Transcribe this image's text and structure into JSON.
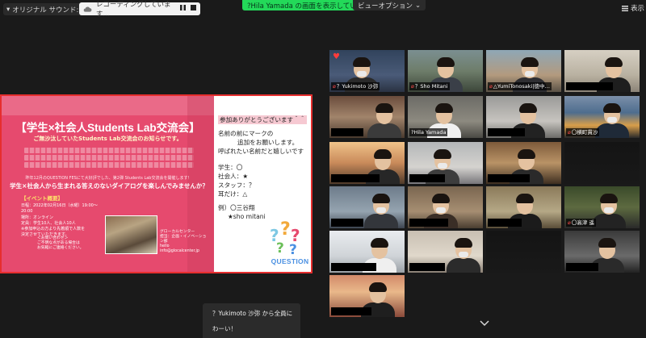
{
  "topbar": {
    "sound_label": "オリジナル サウンド: オフ",
    "recording_label": "レコーディングしています...",
    "share_banner": "?Hila Yamada の画面を表示しています",
    "view_options": "ビューオプション",
    "view_label": "表示"
  },
  "slide": {
    "title": "【学生×社会人Students Lab交流会】",
    "subtitle": "ご無沙汰していたStudents Lab交流会のお知らせです。",
    "small_text": "昨年12月のQUESTION FESにて大好評でした、第2弾 Students Lab交流会を開催します！",
    "question": "学生×社会人から生まれる答えのないダイアログを楽しんでみませんか？",
    "info_heading": "【イベント概要】",
    "info_lines": [
      "日程：2022年02月16日（水曜）19:00～20:00",
      "場所：オンライン",
      "定員：学生10人、社会人10人",
      "※参加申込の方より先着順で人数を",
      "決定させていただきます。"
    ],
    "contact_lines": [
      "＜お問い合わせ＞",
      "ご不明な点がある場合は",
      "お気軽にご連絡ください。"
    ],
    "contact2_lines": [
      "グローカルセンター",
      "担当：企画・イノベーション部",
      "hello",
      "info@glocalcenter.jp"
    ],
    "message_greeting": "参加ありがとうございます＾＾",
    "message_lines": [
      "名前の前にマークの",
      "追加をお願いします。",
      "呼ばれたい名前だと嬉しいです"
    ],
    "marks": [
      "学生：〇",
      "社会人：★",
      "スタッフ：？",
      "耳だけ：△"
    ],
    "example_label": "例）〇三谷翔",
    "example_2": "★sho mitani",
    "logo_text": "QUESTION"
  },
  "gallery": {
    "participants": [
      {
        "name": "？Yukimoto 沙弥",
        "muted": true,
        "heart": true
      },
      {
        "name": "？Sho Mitani",
        "muted": true
      },
      {
        "name": "△YumiTonosaki|徳中…",
        "muted": true
      },
      {
        "name": "",
        "muted": false
      },
      {
        "name": "",
        "muted": false
      },
      {
        "name": "?Hila Yamada",
        "muted": false,
        "active": true
      },
      {
        "name": "",
        "muted": false
      },
      {
        "name": "〇横町貫沙",
        "muted": true
      },
      {
        "name": "",
        "muted": false
      },
      {
        "name": "",
        "muted": false
      },
      {
        "name": "",
        "muted": false
      },
      {
        "name": "",
        "muted": false
      },
      {
        "name": "",
        "muted": false
      },
      {
        "name": "",
        "muted": false
      },
      {
        "name": "",
        "muted": false
      },
      {
        "name": "〇高津 遥",
        "muted": true
      },
      {
        "name": "",
        "muted": false
      },
      {
        "name": "",
        "muted": false
      },
      {
        "name": "",
        "muted": false
      },
      {
        "name": "",
        "muted": false
      },
      {
        "name": "",
        "muted": false
      }
    ]
  },
  "chat": {
    "from": "？Yukimoto 沙弥 から全員に",
    "message": "わーい！"
  },
  "colors": {
    "flyer_pink": "#e64a6e",
    "share_green": "#23d959",
    "slide_border": "#e62e2e",
    "active_speaker": "#d6d33a"
  }
}
